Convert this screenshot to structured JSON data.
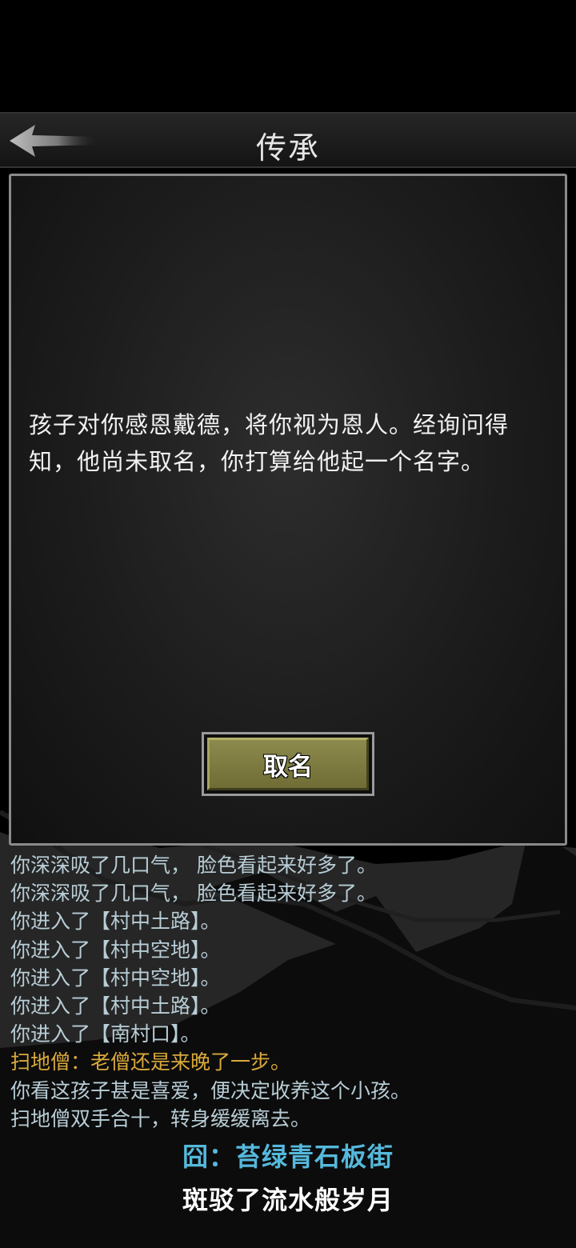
{
  "header": {
    "title": "传承",
    "back_icon": "back-arrow-icon"
  },
  "dialog": {
    "message": "孩子对你感恩戴德，将你视为恩人。经询问得知，他尚未取名，你打算给他起一个名字。",
    "name_button_label": "取名"
  },
  "log": [
    {
      "text": "你深深吸了几口气， 脸色看起来好多了。",
      "style": "normal"
    },
    {
      "text": "你深深吸了几口气， 脸色看起来好多了。",
      "style": "normal"
    },
    {
      "text": "你进入了【村中土路】。",
      "style": "normal"
    },
    {
      "text": "你进入了【村中空地】。",
      "style": "normal"
    },
    {
      "text": "你进入了【村中空地】。",
      "style": "normal"
    },
    {
      "text": "你进入了【村中土路】。",
      "style": "normal"
    },
    {
      "text": "你进入了【南村口】。",
      "style": "normal"
    },
    {
      "text": "扫地僧：老僧还是来晚了一步。",
      "style": "yellow"
    },
    {
      "text": "你看这孩子甚是喜爱，便决定收养这个小孩。",
      "style": "normal"
    },
    {
      "text": "扫地僧双手合十，转身缓缓离去。",
      "style": "normal"
    }
  ],
  "location": "囧：苔绿青石板街",
  "subtitle": "斑驳了流水般岁月",
  "colors": {
    "log_text": "#b8cdd6",
    "log_speech": "#d9a93b",
    "location": "#55b9dc",
    "button": "#7f7d41"
  }
}
